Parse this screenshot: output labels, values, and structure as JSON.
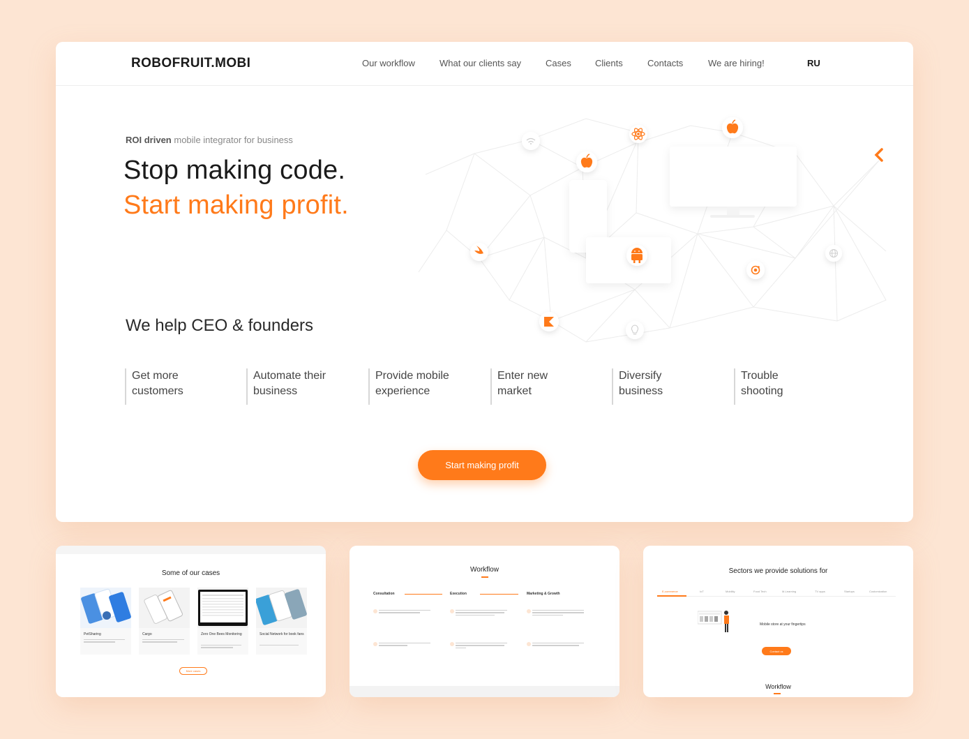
{
  "header": {
    "logo": "ROBOFRUIT.MOBI",
    "nav": [
      {
        "label": "Our workflow"
      },
      {
        "label": "What our clients say"
      },
      {
        "label": "Cases"
      },
      {
        "label": "Clients"
      },
      {
        "label": "Contacts"
      },
      {
        "label": "We are hiring!"
      }
    ],
    "lang": "RU"
  },
  "hero": {
    "tagline_bold": "ROI driven",
    "tagline_rest": "mobile integrator for business",
    "title_line1": "Stop making code.",
    "title_line2": "Start making profit.",
    "icons": [
      "wifi-icon",
      "react-icon",
      "apple-icon",
      "apple-icon",
      "flutter-icon",
      "swift-icon",
      "android-icon",
      "ionic-icon",
      "globe-icon",
      "kotlin-icon",
      "bulb-icon"
    ]
  },
  "benefits": {
    "title": "We help CEO & founders",
    "items": [
      {
        "line1": "Get more",
        "line2": "customers"
      },
      {
        "line1": "Automate their",
        "line2": "business"
      },
      {
        "line1": "Provide mobile",
        "line2": "experience"
      },
      {
        "line1": "Enter new",
        "line2": "market"
      },
      {
        "line1": "Diversify",
        "line2": "business"
      },
      {
        "line1": "Trouble",
        "line2": "shooting"
      }
    ],
    "cta": "Start making profit"
  },
  "thumbnails": {
    "cases": {
      "title": "Some of our cases",
      "items": [
        {
          "name": "PetSharing"
        },
        {
          "name": "Cargo"
        },
        {
          "name": "Zero One Bees Monitoring"
        },
        {
          "name": "Social Network for book fans"
        }
      ],
      "button": "More cases"
    },
    "workflow": {
      "title": "Workflow",
      "stages": [
        "Consultation",
        "Execution",
        "Marketing & Growth"
      ]
    },
    "sectors": {
      "title": "Sectors we provide solutions for",
      "tabs": [
        "E-commerce",
        "IoT",
        "Mobility",
        "Food Tech",
        "M-Learning",
        "TV apps",
        "Startups",
        "Customization"
      ],
      "caption": "Mobile store at your fingertips",
      "button": "Contact us",
      "footer_title": "Workflow"
    }
  },
  "colors": {
    "accent": "#ff7a1a",
    "background": "#fde5d3"
  }
}
